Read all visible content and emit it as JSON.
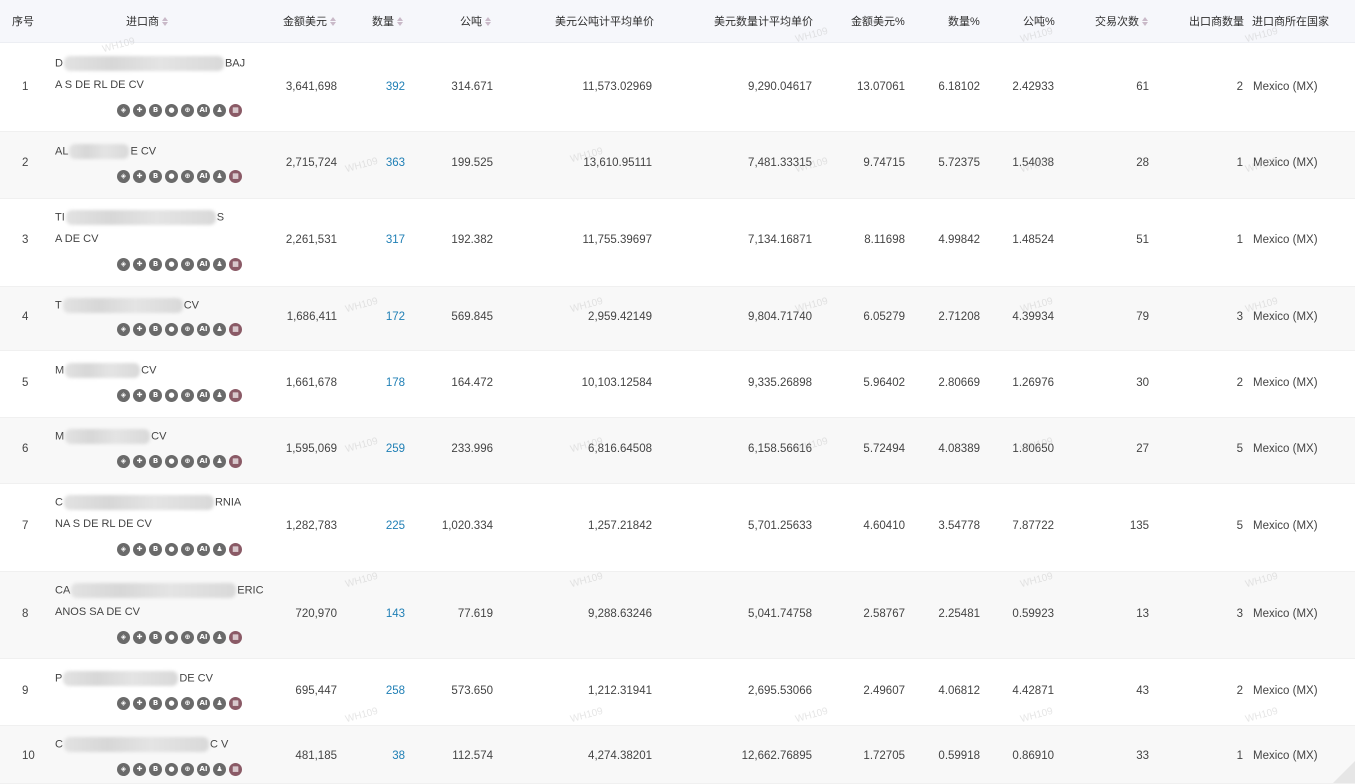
{
  "headers": {
    "index": "序号",
    "importer": "进口商",
    "amount_usd": "金额美元",
    "quantity": "数量",
    "tons": "公吨",
    "usd_per_ton": "美元公吨计平均单价",
    "usd_per_qty": "美元数量计平均单价",
    "amount_pct": "金额美元%",
    "qty_pct": "数量%",
    "tons_pct": "公吨%",
    "trades": "交易次数",
    "exporter_count": "出口商数量",
    "country": "进口商所在国家"
  },
  "watermark": "WH109",
  "icon_names": [
    "locate-icon",
    "compass-icon",
    "bill-of-lading-icon",
    "record-icon",
    "globe-icon",
    "ai-icon",
    "contacts-icon",
    "flag-icon"
  ],
  "icon_glyphs": [
    "◈",
    "✚",
    "B",
    "●",
    "⊕",
    "AI",
    "♟",
    "▦"
  ],
  "rows": [
    {
      "index": "1",
      "name1": "D",
      "name1_end": "BAJ",
      "name2": "A S DE RL DE CV",
      "amount": "3,641,698",
      "qty": "392",
      "tons": "314.671",
      "usd_ton": "11,573.02969",
      "usd_qty": "9,290.04617",
      "amount_pct": "13.07061",
      "qty_pct": "6.18102",
      "tons_pct": "2.42933",
      "trades": "61",
      "exporters": "2",
      "country": "Mexico (MX)"
    },
    {
      "index": "2",
      "name1": "AL",
      "name1_end": "E CV",
      "name2": "",
      "amount": "2,715,724",
      "qty": "363",
      "tons": "199.525",
      "usd_ton": "13,610.95111",
      "usd_qty": "7,481.33315",
      "amount_pct": "9.74715",
      "qty_pct": "5.72375",
      "tons_pct": "1.54038",
      "trades": "28",
      "exporters": "1",
      "country": "Mexico (MX)"
    },
    {
      "index": "3",
      "name1": "TI",
      "name1_end": "S",
      "name2": "A DE CV",
      "amount": "2,261,531",
      "qty": "317",
      "tons": "192.382",
      "usd_ton": "11,755.39697",
      "usd_qty": "7,134.16871",
      "amount_pct": "8.11698",
      "qty_pct": "4.99842",
      "tons_pct": "1.48524",
      "trades": "51",
      "exporters": "1",
      "country": "Mexico (MX)"
    },
    {
      "index": "4",
      "name1": "T",
      "name1_end": "CV",
      "name2": "",
      "amount": "1,686,411",
      "qty": "172",
      "tons": "569.845",
      "usd_ton": "2,959.42149",
      "usd_qty": "9,804.71740",
      "amount_pct": "6.05279",
      "qty_pct": "2.71208",
      "tons_pct": "4.39934",
      "trades": "79",
      "exporters": "3",
      "country": "Mexico (MX)"
    },
    {
      "index": "5",
      "name1": "M",
      "name1_end": "CV",
      "name2": "",
      "amount": "1,661,678",
      "qty": "178",
      "tons": "164.472",
      "usd_ton": "10,103.12584",
      "usd_qty": "9,335.26898",
      "amount_pct": "5.96402",
      "qty_pct": "2.80669",
      "tons_pct": "1.26976",
      "trades": "30",
      "exporters": "2",
      "country": "Mexico (MX)"
    },
    {
      "index": "6",
      "name1": "M",
      "name1_end": "CV",
      "name2": "",
      "amount": "1,595,069",
      "qty": "259",
      "tons": "233.996",
      "usd_ton": "6,816.64508",
      "usd_qty": "6,158.56616",
      "amount_pct": "5.72494",
      "qty_pct": "4.08389",
      "tons_pct": "1.80650",
      "trades": "27",
      "exporters": "5",
      "country": "Mexico (MX)"
    },
    {
      "index": "7",
      "name1": "C",
      "name1_end": "RNIA",
      "name2": "NA S DE RL DE CV",
      "amount": "1,282,783",
      "qty": "225",
      "tons": "1,020.334",
      "usd_ton": "1,257.21842",
      "usd_qty": "5,701.25633",
      "amount_pct": "4.60410",
      "qty_pct": "3.54778",
      "tons_pct": "7.87722",
      "trades": "135",
      "exporters": "5",
      "country": "Mexico (MX)"
    },
    {
      "index": "8",
      "name1": "CA",
      "name1_end": "ERIC",
      "name2": "ANOS SA DE CV",
      "amount": "720,970",
      "qty": "143",
      "tons": "77.619",
      "usd_ton": "9,288.63246",
      "usd_qty": "5,041.74758",
      "amount_pct": "2.58767",
      "qty_pct": "2.25481",
      "tons_pct": "0.59923",
      "trades": "13",
      "exporters": "3",
      "country": "Mexico (MX)"
    },
    {
      "index": "9",
      "name1": "P",
      "name1_end": "DE CV",
      "name2": "",
      "amount": "695,447",
      "qty": "258",
      "tons": "573.650",
      "usd_ton": "1,212.31941",
      "usd_qty": "2,695.53066",
      "amount_pct": "2.49607",
      "qty_pct": "4.06812",
      "tons_pct": "4.42871",
      "trades": "43",
      "exporters": "2",
      "country": "Mexico (MX)"
    },
    {
      "index": "10",
      "name1": "C",
      "name1_end": "C V",
      "name2": "",
      "amount": "481,185",
      "qty": "38",
      "tons": "112.574",
      "usd_ton": "4,274.38201",
      "usd_qty": "12,662.76895",
      "amount_pct": "1.72705",
      "qty_pct": "0.59918",
      "tons_pct": "0.86910",
      "trades": "33",
      "exporters": "1",
      "country": "Mexico (MX)"
    }
  ]
}
